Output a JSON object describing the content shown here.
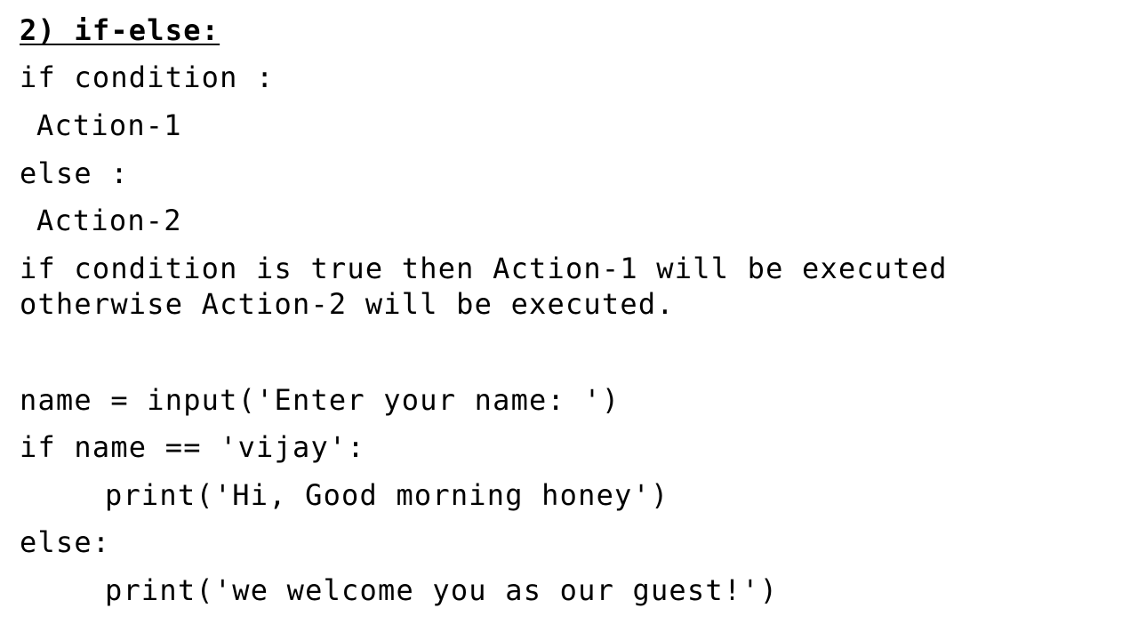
{
  "heading": "2) if-else:",
  "syntax": {
    "line1": "if condition :",
    "line2": "Action-1",
    "line3": "else :",
    "line4": "Action-2"
  },
  "explanation": {
    "line1": "if condition is true then Action-1 will be executed",
    "line2": "otherwise Action-2 will be executed."
  },
  "example": {
    "line1": "name = input('Enter your name: ')",
    "line2": "if name == 'vijay':",
    "line3": "print('Hi, Good morning honey')",
    "line4": "else:",
    "line5": "print('we welcome you as our guest!')"
  }
}
